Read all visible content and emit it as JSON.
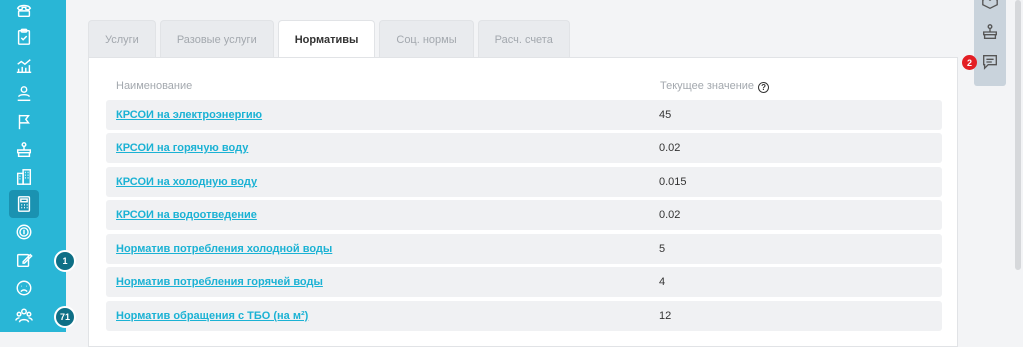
{
  "sidebar": {
    "items": [
      {
        "icon": "phone-icon"
      },
      {
        "icon": "clipboard-icon"
      },
      {
        "icon": "chart-icon"
      },
      {
        "icon": "people-icon"
      },
      {
        "icon": "flag-icon"
      },
      {
        "icon": "weight-scale-icon"
      },
      {
        "icon": "buildings-icon"
      },
      {
        "icon": "calculator-icon",
        "active": true
      },
      {
        "icon": "coin-icon"
      },
      {
        "icon": "edit-icon",
        "badge": "1"
      },
      {
        "icon": "sad-face-icon"
      },
      {
        "icon": "group-icon",
        "badge": "71"
      }
    ]
  },
  "tabs": [
    {
      "label": "Услуги"
    },
    {
      "label": "Разовые услуги"
    },
    {
      "label": "Нормативы",
      "active": true
    },
    {
      "label": "Соц. нормы"
    },
    {
      "label": "Расч. счета"
    }
  ],
  "table": {
    "col_name": "Наименование",
    "col_value": "Текущее значение",
    "help_glyph": "?",
    "rows": [
      {
        "name": "КРСОИ на электроэнергию",
        "value": "45"
      },
      {
        "name": "КРСОИ на горячую воду",
        "value": "0.02"
      },
      {
        "name": "КРСОИ на холодную воду",
        "value": "0.015"
      },
      {
        "name": "КРСОИ на водоотведение",
        "value": "0.02"
      },
      {
        "name": "Норматив потребления холодной воды",
        "value": "5"
      },
      {
        "name": "Норматив потребления горячей воды",
        "value": "4"
      },
      {
        "name": "Норматив обращения с ТБО (на м²)",
        "value": "12"
      }
    ]
  },
  "rightbar": {
    "chat_badge": "2"
  },
  "colors": {
    "sidebar": "#29b6d6",
    "link": "#1bb2d4",
    "badge_red": "#e31e24"
  }
}
